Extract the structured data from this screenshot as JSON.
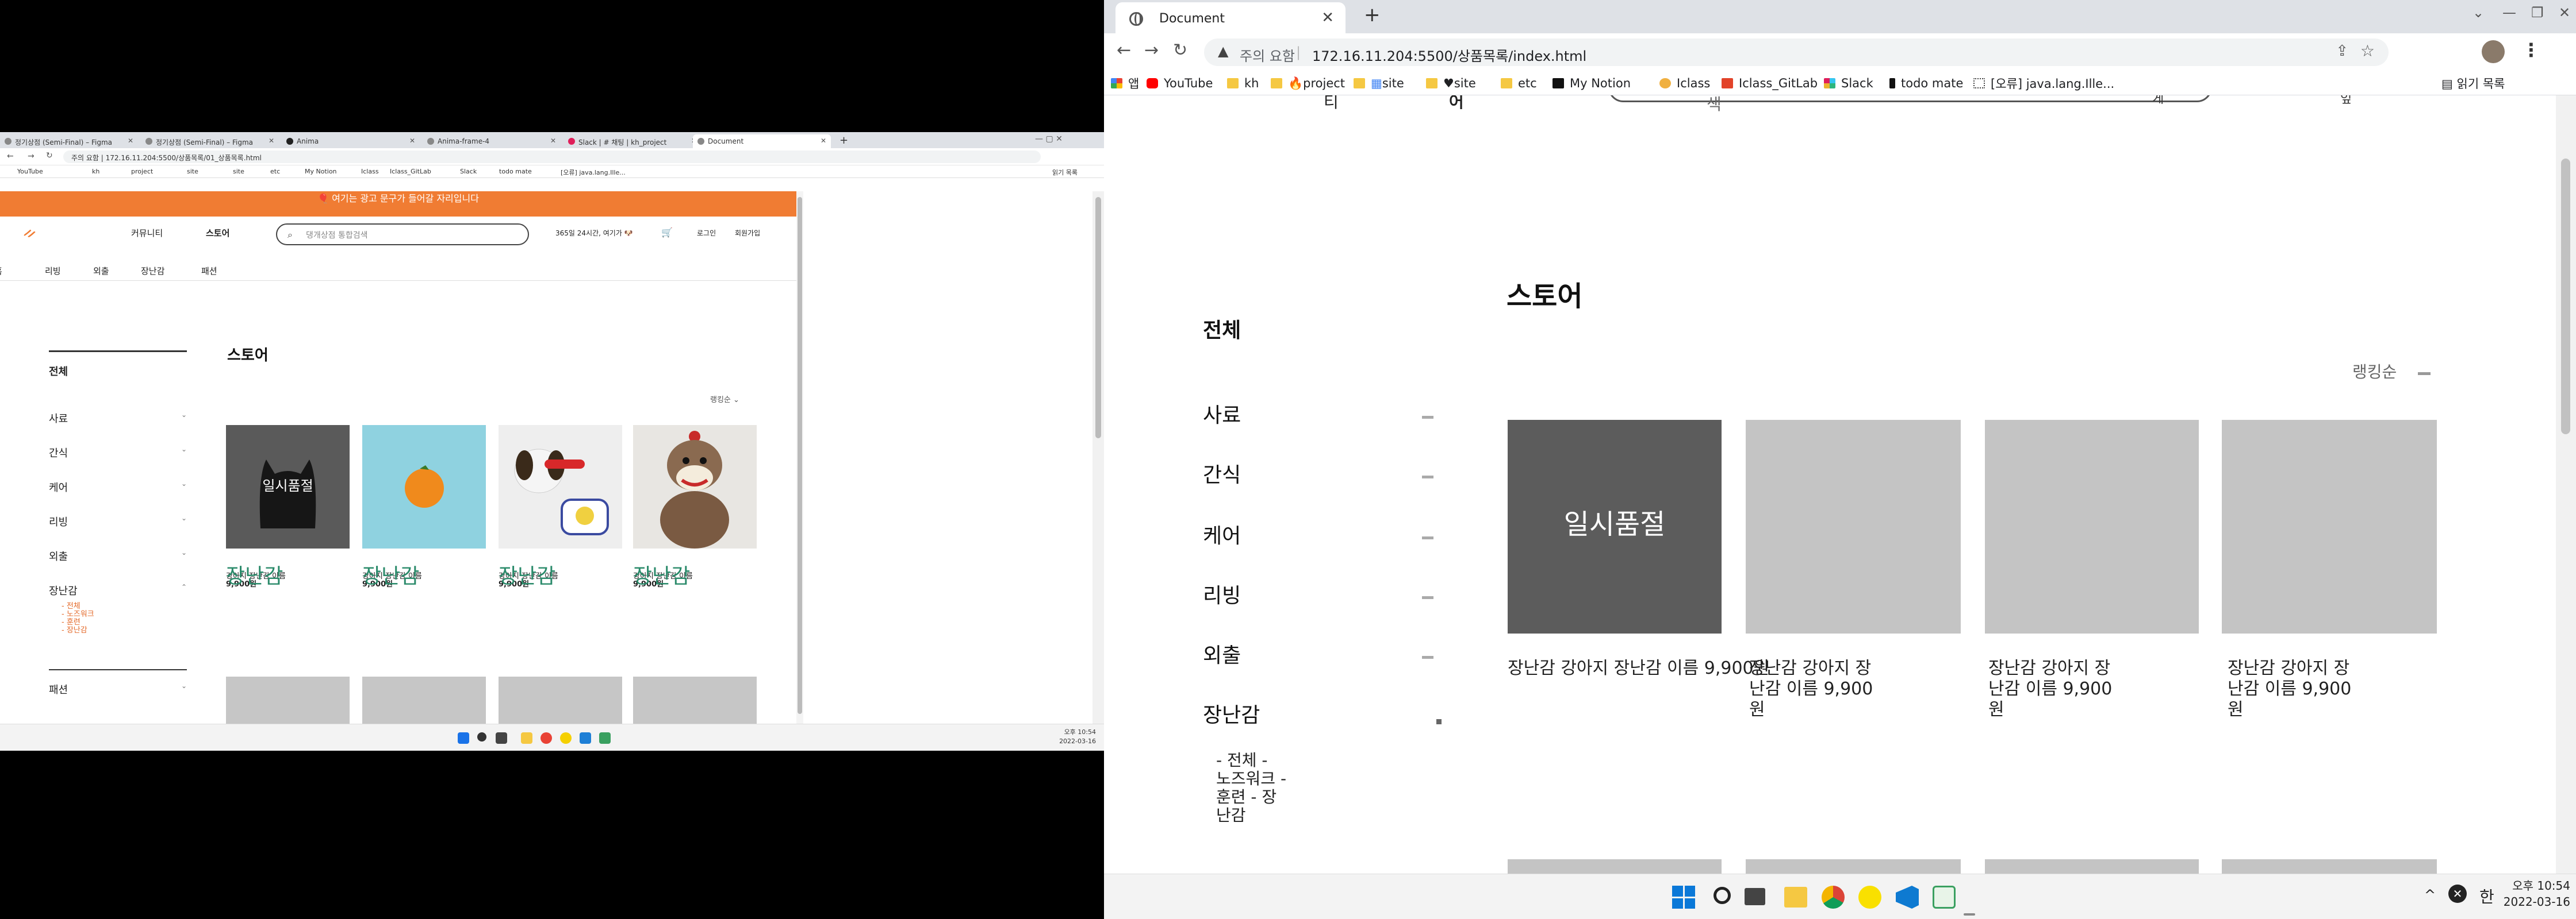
{
  "left_window": {
    "tabs": [
      "정기상점 (Semi-Final) – Figma",
      "정기상점 (Semi-Final) – Figma",
      "Anima",
      "Anima-frame-4",
      "Slack | # 채팅 | kh_project",
      "Document"
    ],
    "url": "주의 요함 | 172.16.11.204:5500/상품목록/01_상품목록.html",
    "bookmarks": [
      "YouTube",
      "kh",
      "project",
      "site",
      "site",
      "etc",
      "My Notion",
      "Iclass",
      "Iclass_GitLab",
      "Slack",
      "todo mate",
      "[오류] java.lang.Ille...",
      "읽기 목록"
    ],
    "banner": "🎈 여기는 광고 문구가 들어갈 자리입니다",
    "nav": [
      "커뮤니티",
      "스토어"
    ],
    "search_placeholder": "댕개상점 통합검색",
    "header_right": [
      "365일 24시간, 여기가 🐶",
      "로그인",
      "회원가입"
    ],
    "subnav": [
      "홈",
      "리빙",
      "외출",
      "장난감",
      "패션"
    ],
    "sidebar": [
      "전체",
      "사료",
      "간식",
      "케어",
      "리빙",
      "외출",
      "장난감",
      "패션"
    ],
    "toy_sub": [
      "- 전체",
      "- 노즈워크",
      "- 훈련",
      "- 장난감"
    ],
    "title": "스토어",
    "sort": "랭킹순",
    "products": [
      {
        "category": "장난감",
        "name": "강아지 장난감 이름",
        "price": "9,900원"
      },
      {
        "category": "장난감",
        "name": "강아지 장난감 이름",
        "price": "9,900원"
      },
      {
        "category": "장난감",
        "name": "강아지 장난감 이름",
        "price": "9,900원"
      },
      {
        "category": "장난감",
        "name": "강아지 장난감 이름",
        "price": "9,900원"
      }
    ],
    "soldout": "일시품절",
    "clock_time": "오후 10:54",
    "clock_date": "2022-03-16"
  },
  "right_window": {
    "tab_title": "Document",
    "omnibox_warning": "주의 요함",
    "url": "172.16.11.204:5500/상품목록/index.html",
    "bookmarks": {
      "apps": "앱",
      "youtube": "YouTube",
      "kh": "kh",
      "project": "project",
      "site1": "site",
      "site2": "site",
      "etc": "etc",
      "notion": "My Notion",
      "iclass": "Iclass",
      "gitlab": "Iclass_GitLab",
      "slack": "Slack",
      "todo": "todo mate",
      "error": "[오류] java.lang.Ille...",
      "reading": "읽기 목록"
    },
    "top_fragments": [
      "티",
      "어",
      "색",
      "게",
      "잎"
    ],
    "page_title": "스토어",
    "categories": [
      "전체",
      "사료",
      "간식",
      "케어",
      "리빙",
      "외출",
      "장난감"
    ],
    "toy_sub": "- 전체 -\n노즈워크 -\n훈련 - 장\n난감",
    "sort_label": "랭킹순",
    "soldout_label": "일시품절",
    "captions": [
      "장난감 강아지 장난감 이름 9,900원",
      "장난감 강아지 장\n난감 이름 9,900\n원",
      "장난감 강아지 장\n난감 이름 9,900\n원",
      "장난감 강아지 장\n난감 이름 9,900\n원"
    ],
    "taskbar": {
      "tray_lang": "한",
      "time": "오후 10:54",
      "date": "2022-03-16"
    }
  }
}
